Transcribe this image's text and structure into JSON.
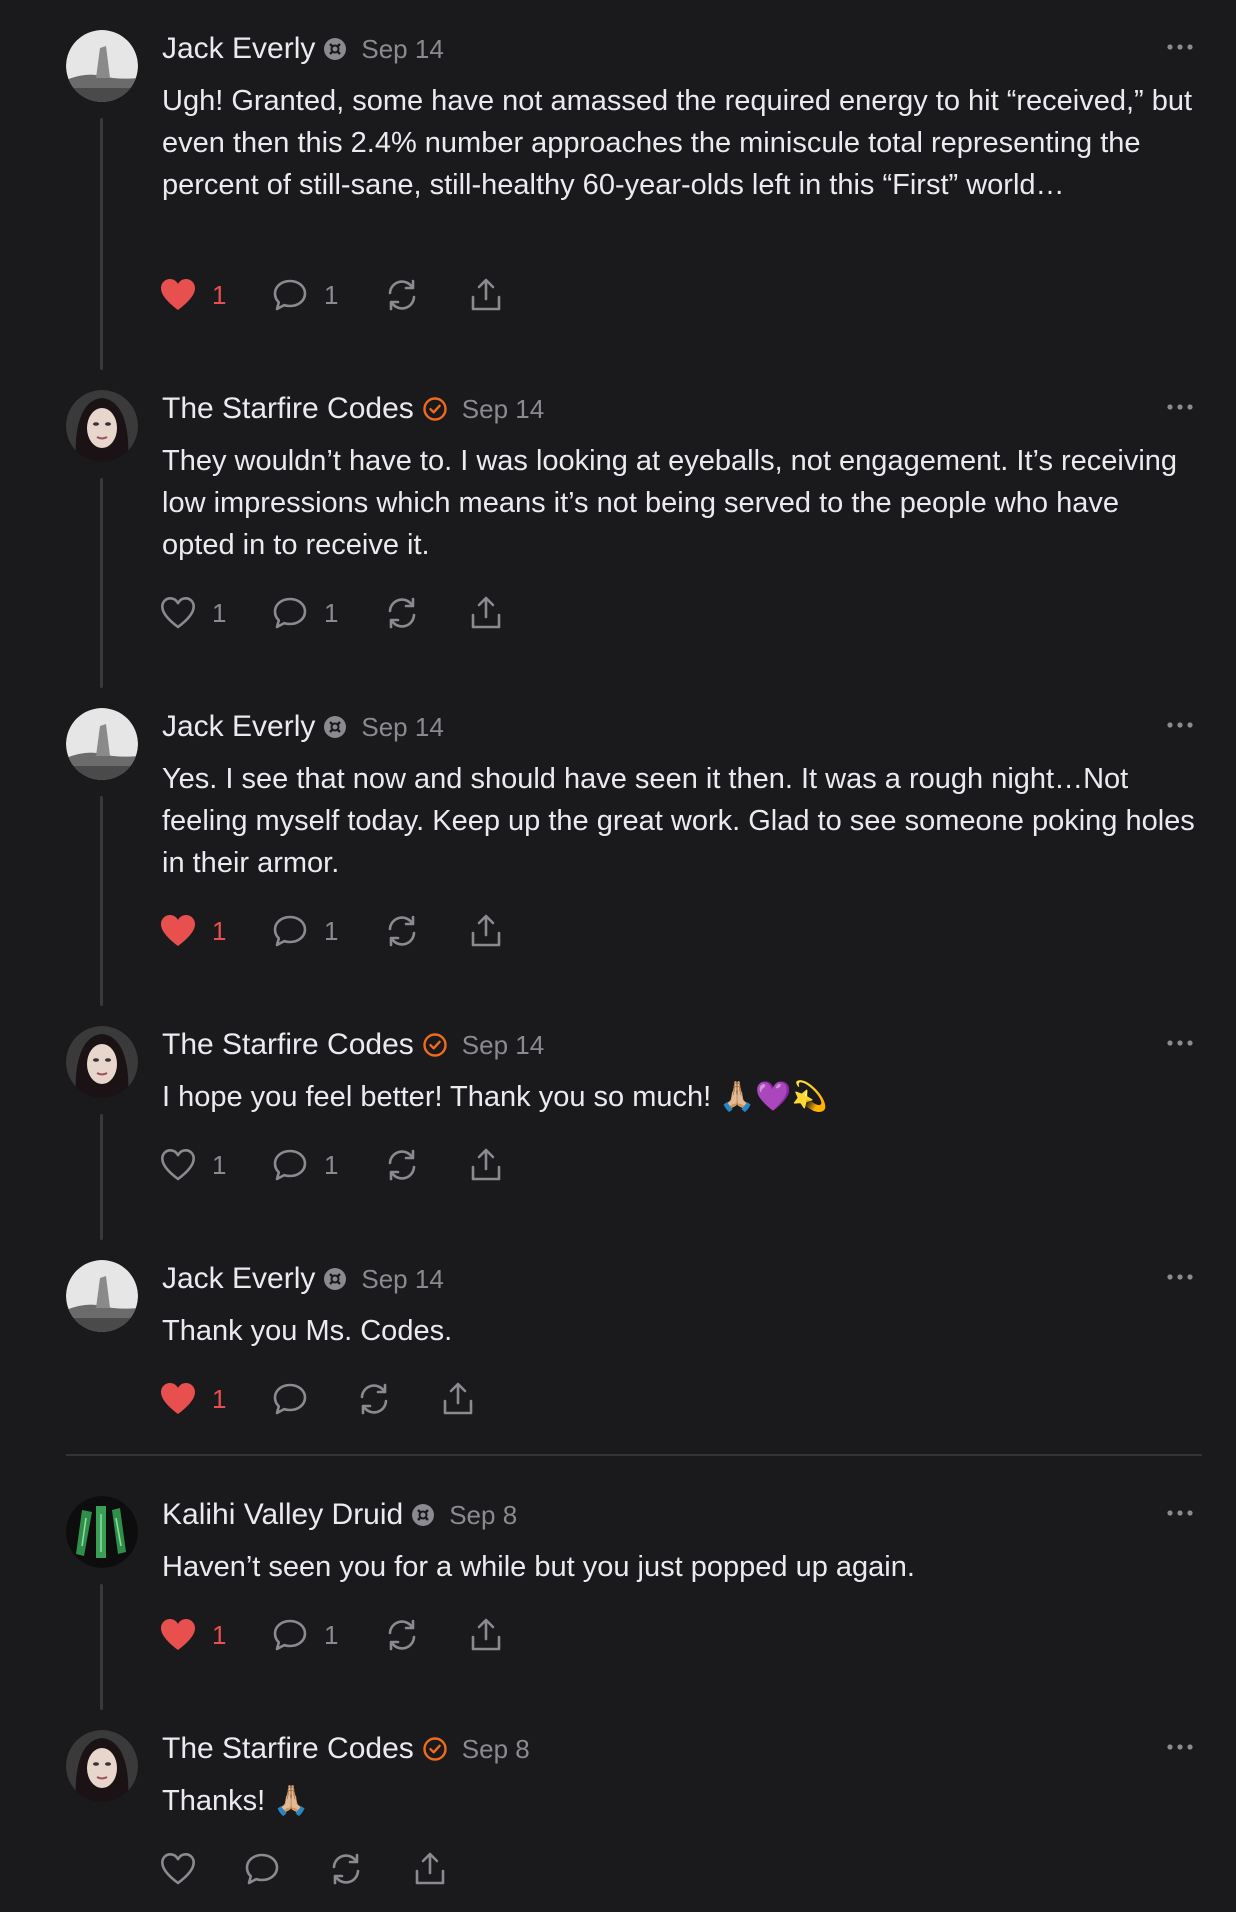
{
  "colors": {
    "background": "#1a1a1c",
    "text": "#eceaf0",
    "muted": "#8a8a90",
    "like_red": "#e8504f",
    "verified_orange": "#f26a1b"
  },
  "comments": [
    {
      "author": "Jack Everly",
      "badge": "subscriber-icon",
      "date": "Sep 14",
      "text": "Ugh! Granted, some have not amassed the required energy to hit “received,” but even then this 2.4% number approaches the miniscule total representing the percent of still-sane, still-healthy 60-year-olds left in this “First” world…",
      "liked": true,
      "likes": "1",
      "replies": "1"
    },
    {
      "author": "The Starfire Codes",
      "badge": "verified-check-icon",
      "date": "Sep 14",
      "text": "They wouldn’t have to. I was looking at eyeballs, not engagement. It’s receiving low impressions which means it’s not being served to the people who have opted in to receive it.",
      "liked": false,
      "likes": "1",
      "replies": "1"
    },
    {
      "author": "Jack Everly",
      "badge": "subscriber-icon",
      "date": "Sep 14",
      "text": "Yes. I see that now and should have seen it then. It was a rough night…Not feeling myself today. Keep up the great work. Glad to see someone poking holes in their armor.",
      "liked": true,
      "likes": "1",
      "replies": "1"
    },
    {
      "author": "The Starfire Codes",
      "badge": "verified-check-icon",
      "date": "Sep 14",
      "text": "I hope you feel better! Thank you so much! 🙏🏼💜💫",
      "liked": false,
      "likes": "1",
      "replies": "1"
    },
    {
      "author": "Jack Everly",
      "badge": "subscriber-icon",
      "date": "Sep 14",
      "text": "Thank you Ms. Codes.",
      "liked": true,
      "likes": "1",
      "replies": ""
    },
    {
      "author": "Kalihi Valley Druid",
      "badge": "subscriber-icon",
      "date": "Sep 8",
      "text": "Haven’t seen you for a while but you just popped up again.",
      "liked": true,
      "likes": "1",
      "replies": "1"
    },
    {
      "author": "The Starfire Codes",
      "badge": "verified-check-icon",
      "date": "Sep 8",
      "text": "Thanks! 🙏🏼",
      "liked": false,
      "likes": "",
      "replies": ""
    }
  ]
}
